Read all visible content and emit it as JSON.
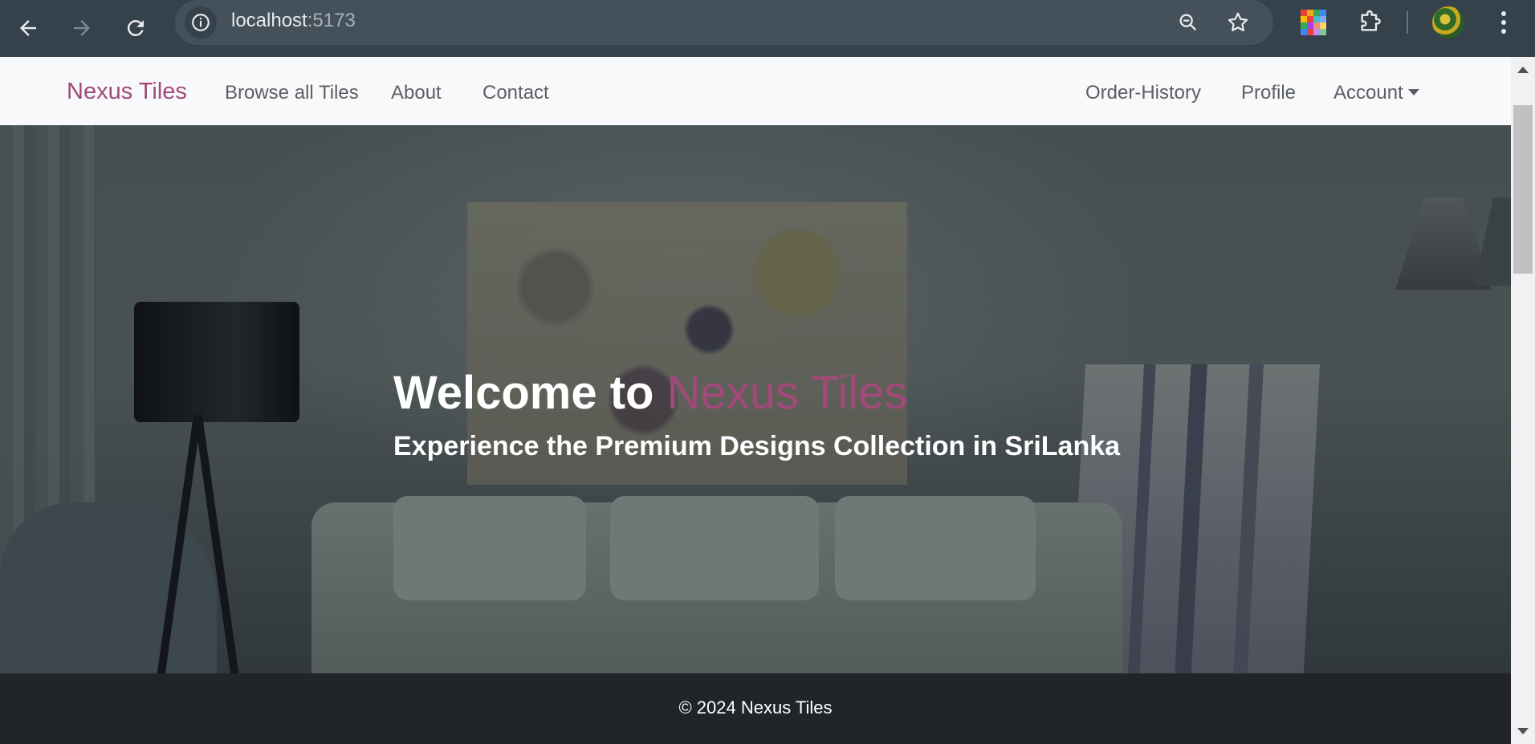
{
  "browser": {
    "url_host": "localhost",
    "url_port": ":5173",
    "icons": [
      "back-icon",
      "forward-icon",
      "reload-icon",
      "site-info-icon",
      "zoom-icon",
      "bookmark-star-icon",
      "extension-icon",
      "puzzle-icon",
      "profile-avatar",
      "menu-dots-icon"
    ]
  },
  "navbar": {
    "brand": "Nexus Tiles",
    "links": [
      "Browse all Tiles",
      "About",
      "Contact"
    ],
    "right_links": [
      "Order-History",
      "Profile"
    ],
    "account_label": "Account"
  },
  "hero": {
    "title_prefix": "Welcome to ",
    "title_accent": "Nexus Tiles",
    "subtitle": "Experience the Premium Designs Collection in SriLanka"
  },
  "footer": {
    "text": "© 2024 Nexus Tiles"
  },
  "colors": {
    "brand": "#a14a7a",
    "footer_bg": "#212529",
    "navbar_bg": "#f8f9fa",
    "chrome_bg": "#35414b"
  }
}
